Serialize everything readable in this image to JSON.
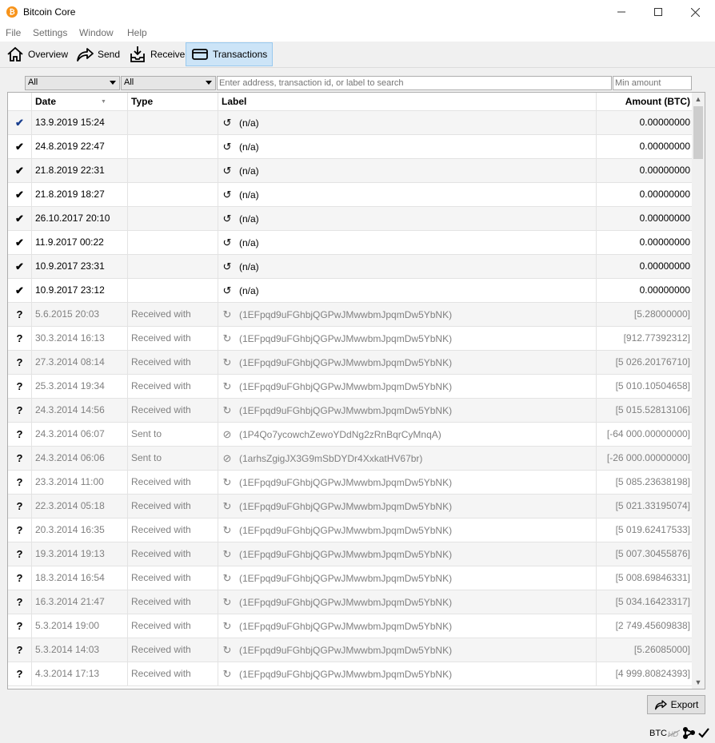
{
  "window": {
    "title": "Bitcoin Core",
    "app_icon_glyph": "₿"
  },
  "menu": {
    "file": "File",
    "settings": "Settings",
    "window": "Window",
    "help": "Help"
  },
  "toolbar": {
    "overview": "Overview",
    "send": "Send",
    "receive": "Receive",
    "transactions": "Transactions"
  },
  "filters": {
    "date_selected": "All",
    "type_selected": "All",
    "search_placeholder": "Enter address, transaction id, or label to search",
    "min_amount_placeholder": "Min amount"
  },
  "table": {
    "headers": {
      "date": "Date",
      "type": "Type",
      "label": "Label",
      "amount": "Amount (BTC)"
    },
    "rows": [
      {
        "status": "confirmed-check",
        "date": "13.9.2019 15:24",
        "type": "",
        "label": "(n/a)",
        "amount": "0.00000000",
        "unconfirmed": false
      },
      {
        "status": "confirmed-check",
        "date": "24.8.2019 22:47",
        "type": "",
        "label": "(n/a)",
        "amount": "0.00000000",
        "unconfirmed": false
      },
      {
        "status": "confirmed-check",
        "date": "21.8.2019 22:31",
        "type": "",
        "label": "(n/a)",
        "amount": "0.00000000",
        "unconfirmed": false
      },
      {
        "status": "confirmed-check",
        "date": "21.8.2019 18:27",
        "type": "",
        "label": "(n/a)",
        "amount": "0.00000000",
        "unconfirmed": false
      },
      {
        "status": "confirmed-check",
        "date": "26.10.2017 20:10",
        "type": "",
        "label": "(n/a)",
        "amount": "0.00000000",
        "unconfirmed": false
      },
      {
        "status": "confirmed-check",
        "date": "11.9.2017 00:22",
        "type": "",
        "label": "(n/a)",
        "amount": "0.00000000",
        "unconfirmed": false
      },
      {
        "status": "confirmed-check",
        "date": "10.9.2017 23:31",
        "type": "",
        "label": "(n/a)",
        "amount": "0.00000000",
        "unconfirmed": false
      },
      {
        "status": "confirmed-check",
        "date": "10.9.2017 23:12",
        "type": "",
        "label": "(n/a)",
        "amount": "0.00000000",
        "unconfirmed": false
      },
      {
        "status": "unknown",
        "date": "5.6.2015 20:03",
        "type": "Received with",
        "label": "(1EFpqd9uFGhbjQGPwJMwwbmJpqmDw5YbNK)",
        "amount": "[5.28000000]",
        "unconfirmed": true
      },
      {
        "status": "unknown",
        "date": "30.3.2014 16:13",
        "type": "Received with",
        "label": "(1EFpqd9uFGhbjQGPwJMwwbmJpqmDw5YbNK)",
        "amount": "[912.77392312]",
        "unconfirmed": true
      },
      {
        "status": "unknown",
        "date": "27.3.2014 08:14",
        "type": "Received with",
        "label": "(1EFpqd9uFGhbjQGPwJMwwbmJpqmDw5YbNK)",
        "amount": "[5 026.20176710]",
        "unconfirmed": true
      },
      {
        "status": "unknown",
        "date": "25.3.2014 19:34",
        "type": "Received with",
        "label": "(1EFpqd9uFGhbjQGPwJMwwbmJpqmDw5YbNK)",
        "amount": "[5 010.10504658]",
        "unconfirmed": true
      },
      {
        "status": "unknown",
        "date": "24.3.2014 14:56",
        "type": "Received with",
        "label": "(1EFpqd9uFGhbjQGPwJMwwbmJpqmDw5YbNK)",
        "amount": "[5 015.52813106]",
        "unconfirmed": true
      },
      {
        "status": "unknown",
        "date": "24.3.2014 06:07",
        "type": "Sent to",
        "label": "(1P4Qo7ycowchZewoYDdNg2zRnBqrCyMnqA)",
        "amount": "[-64 000.00000000]",
        "unconfirmed": true
      },
      {
        "status": "unknown",
        "date": "24.3.2014 06:06",
        "type": "Sent to",
        "label": "(1arhsZgigJX3G9mSbDYDr4XxkatHV67br)",
        "amount": "[-26 000.00000000]",
        "unconfirmed": true
      },
      {
        "status": "unknown",
        "date": "23.3.2014 11:00",
        "type": "Received with",
        "label": "(1EFpqd9uFGhbjQGPwJMwwbmJpqmDw5YbNK)",
        "amount": "[5 085.23638198]",
        "unconfirmed": true
      },
      {
        "status": "unknown",
        "date": "22.3.2014 05:18",
        "type": "Received with",
        "label": "(1EFpqd9uFGhbjQGPwJMwwbmJpqmDw5YbNK)",
        "amount": "[5 021.33195074]",
        "unconfirmed": true
      },
      {
        "status": "unknown",
        "date": "20.3.2014 16:35",
        "type": "Received with",
        "label": "(1EFpqd9uFGhbjQGPwJMwwbmJpqmDw5YbNK)",
        "amount": "[5 019.62417533]",
        "unconfirmed": true
      },
      {
        "status": "unknown",
        "date": "19.3.2014 19:13",
        "type": "Received with",
        "label": "(1EFpqd9uFGhbjQGPwJMwwbmJpqmDw5YbNK)",
        "amount": "[5 007.30455876]",
        "unconfirmed": true
      },
      {
        "status": "unknown",
        "date": "18.3.2014 16:54",
        "type": "Received with",
        "label": "(1EFpqd9uFGhbjQGPwJMwwbmJpqmDw5YbNK)",
        "amount": "[5 008.69846331]",
        "unconfirmed": true
      },
      {
        "status": "unknown",
        "date": "16.3.2014 21:47",
        "type": "Received with",
        "label": "(1EFpqd9uFGhbjQGPwJMwwbmJpqmDw5YbNK)",
        "amount": "[5 034.16423317]",
        "unconfirmed": true
      },
      {
        "status": "unknown",
        "date": "5.3.2014 19:00",
        "type": "Received with",
        "label": "(1EFpqd9uFGhbjQGPwJMwwbmJpqmDw5YbNK)",
        "amount": "[2 749.45609838]",
        "unconfirmed": true
      },
      {
        "status": "unknown",
        "date": "5.3.2014 14:03",
        "type": "Received with",
        "label": "(1EFpqd9uFGhbjQGPwJMwwbmJpqmDw5YbNK)",
        "amount": "[5.26085000]",
        "unconfirmed": true
      },
      {
        "status": "unknown",
        "date": "4.3.2014 17:13",
        "type": "Received with",
        "label": "(1EFpqd9uFGhbjQGPwJMwwbmJpqmDw5YbNK)",
        "amount": "[4 999.80824393]",
        "unconfirmed": true
      }
    ]
  },
  "export_label": "Export",
  "statusbar": {
    "unit": "BTC"
  }
}
